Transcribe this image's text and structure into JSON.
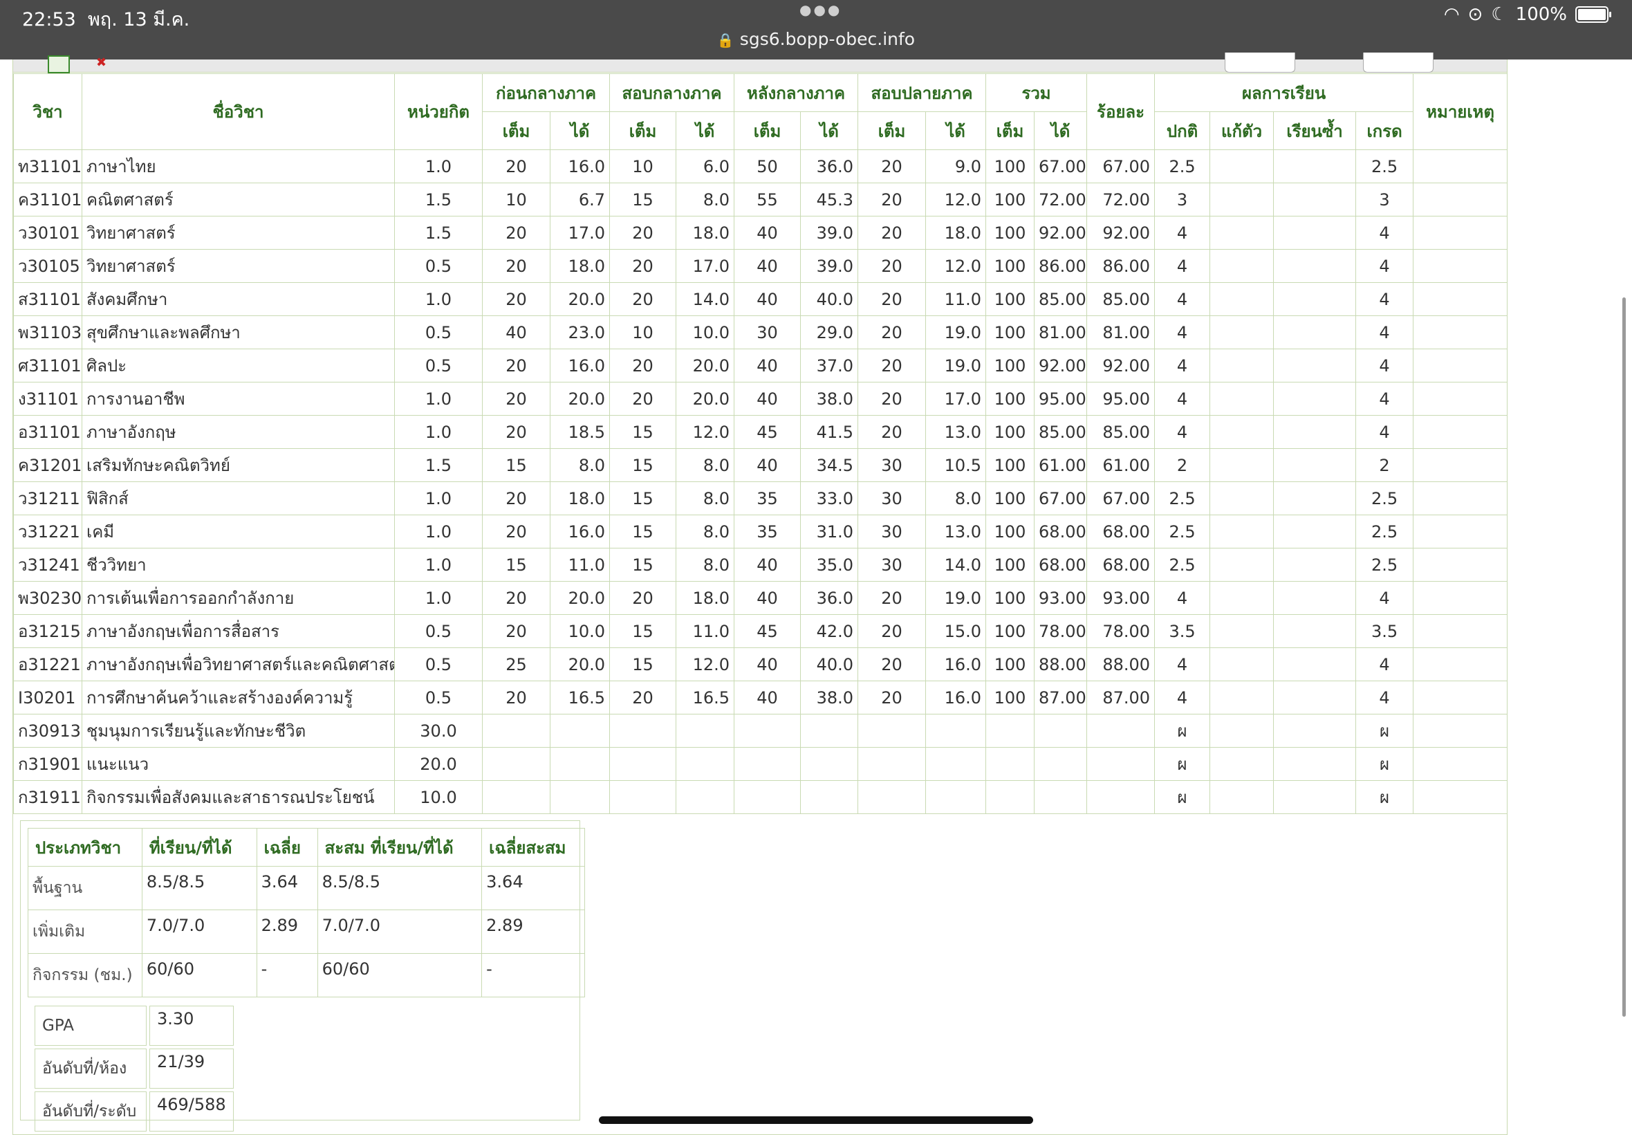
{
  "status": {
    "time": "22:53",
    "date": "พฤ. 13 มี.ค.",
    "url": "sgs6.bopp-obec.info",
    "battery": "100%"
  },
  "headers": {
    "subject_code": "วิชา",
    "subject_name": "ชื่อวิชา",
    "credits": "หน่วยกิต",
    "before_mid": "ก่อนกลางภาค",
    "midterm": "สอบกลางภาค",
    "after_mid": "หลังกลางภาค",
    "final": "สอบปลายภาค",
    "total": "รวม",
    "percent": "ร้อยละ",
    "results": "ผลการเรียน",
    "remark": "หมายเหตุ",
    "full": "เต็ม",
    "got": "ได้",
    "normal": "ปกติ",
    "fix": "แก้ตัว",
    "repeat": "เรียนซ้ำ",
    "grade": "เกรด"
  },
  "rows": [
    {
      "c0": "ท31101",
      "c1": "ภาษาไทย",
      "c2": "1.0",
      "c3": "20",
      "c4": "16.0",
      "c5": "10",
      "c6": "6.0",
      "c7": "50",
      "c8": "36.0",
      "c9": "20",
      "c10": "9.0",
      "c11": "100",
      "c12": "67.00",
      "c13": "67.00",
      "c14": "2.5",
      "c15": "",
      "c16": "",
      "c17": "2.5",
      "c18": ""
    },
    {
      "c0": "ค31101",
      "c1": "คณิตศาสตร์",
      "c2": "1.5",
      "c3": "10",
      "c4": "6.7",
      "c5": "15",
      "c6": "8.0",
      "c7": "55",
      "c8": "45.3",
      "c9": "20",
      "c10": "12.0",
      "c11": "100",
      "c12": "72.00",
      "c13": "72.00",
      "c14": "3",
      "c15": "",
      "c16": "",
      "c17": "3",
      "c18": ""
    },
    {
      "c0": "ว30101",
      "c1": "วิทยาศาสตร์",
      "c2": "1.5",
      "c3": "20",
      "c4": "17.0",
      "c5": "20",
      "c6": "18.0",
      "c7": "40",
      "c8": "39.0",
      "c9": "20",
      "c10": "18.0",
      "c11": "100",
      "c12": "92.00",
      "c13": "92.00",
      "c14": "4",
      "c15": "",
      "c16": "",
      "c17": "4",
      "c18": ""
    },
    {
      "c0": "ว30105",
      "c1": "วิทยาศาสตร์",
      "c2": "0.5",
      "c3": "20",
      "c4": "18.0",
      "c5": "20",
      "c6": "17.0",
      "c7": "40",
      "c8": "39.0",
      "c9": "20",
      "c10": "12.0",
      "c11": "100",
      "c12": "86.00",
      "c13": "86.00",
      "c14": "4",
      "c15": "",
      "c16": "",
      "c17": "4",
      "c18": ""
    },
    {
      "c0": "ส31101",
      "c1": "สังคมศึกษา",
      "c2": "1.0",
      "c3": "20",
      "c4": "20.0",
      "c5": "20",
      "c6": "14.0",
      "c7": "40",
      "c8": "40.0",
      "c9": "20",
      "c10": "11.0",
      "c11": "100",
      "c12": "85.00",
      "c13": "85.00",
      "c14": "4",
      "c15": "",
      "c16": "",
      "c17": "4",
      "c18": ""
    },
    {
      "c0": "พ31103",
      "c1": "สุขศึกษาและพลศึกษา",
      "c2": "0.5",
      "c3": "40",
      "c4": "23.0",
      "c5": "10",
      "c6": "10.0",
      "c7": "30",
      "c8": "29.0",
      "c9": "20",
      "c10": "19.0",
      "c11": "100",
      "c12": "81.00",
      "c13": "81.00",
      "c14": "4",
      "c15": "",
      "c16": "",
      "c17": "4",
      "c18": ""
    },
    {
      "c0": "ศ31101",
      "c1": "ศิลปะ",
      "c2": "0.5",
      "c3": "20",
      "c4": "16.0",
      "c5": "20",
      "c6": "20.0",
      "c7": "40",
      "c8": "37.0",
      "c9": "20",
      "c10": "19.0",
      "c11": "100",
      "c12": "92.00",
      "c13": "92.00",
      "c14": "4",
      "c15": "",
      "c16": "",
      "c17": "4",
      "c18": ""
    },
    {
      "c0": "ง31101",
      "c1": "การงานอาชีพ",
      "c2": "1.0",
      "c3": "20",
      "c4": "20.0",
      "c5": "20",
      "c6": "20.0",
      "c7": "40",
      "c8": "38.0",
      "c9": "20",
      "c10": "17.0",
      "c11": "100",
      "c12": "95.00",
      "c13": "95.00",
      "c14": "4",
      "c15": "",
      "c16": "",
      "c17": "4",
      "c18": ""
    },
    {
      "c0": "อ31101",
      "c1": "ภาษาอังกฤษ",
      "c2": "1.0",
      "c3": "20",
      "c4": "18.5",
      "c5": "15",
      "c6": "12.0",
      "c7": "45",
      "c8": "41.5",
      "c9": "20",
      "c10": "13.0",
      "c11": "100",
      "c12": "85.00",
      "c13": "85.00",
      "c14": "4",
      "c15": "",
      "c16": "",
      "c17": "4",
      "c18": ""
    },
    {
      "c0": "ค31201",
      "c1": "เสริมทักษะคณิตวิทย์",
      "c2": "1.5",
      "c3": "15",
      "c4": "8.0",
      "c5": "15",
      "c6": "8.0",
      "c7": "40",
      "c8": "34.5",
      "c9": "30",
      "c10": "10.5",
      "c11": "100",
      "c12": "61.00",
      "c13": "61.00",
      "c14": "2",
      "c15": "",
      "c16": "",
      "c17": "2",
      "c18": ""
    },
    {
      "c0": "ว31211",
      "c1": "ฟิสิกส์",
      "c2": "1.0",
      "c3": "20",
      "c4": "18.0",
      "c5": "15",
      "c6": "8.0",
      "c7": "35",
      "c8": "33.0",
      "c9": "30",
      "c10": "8.0",
      "c11": "100",
      "c12": "67.00",
      "c13": "67.00",
      "c14": "2.5",
      "c15": "",
      "c16": "",
      "c17": "2.5",
      "c18": ""
    },
    {
      "c0": "ว31221",
      "c1": "เคมี",
      "c2": "1.0",
      "c3": "20",
      "c4": "16.0",
      "c5": "15",
      "c6": "8.0",
      "c7": "35",
      "c8": "31.0",
      "c9": "30",
      "c10": "13.0",
      "c11": "100",
      "c12": "68.00",
      "c13": "68.00",
      "c14": "2.5",
      "c15": "",
      "c16": "",
      "c17": "2.5",
      "c18": ""
    },
    {
      "c0": "ว31241",
      "c1": "ชีววิทยา",
      "c2": "1.0",
      "c3": "15",
      "c4": "11.0",
      "c5": "15",
      "c6": "8.0",
      "c7": "40",
      "c8": "35.0",
      "c9": "30",
      "c10": "14.0",
      "c11": "100",
      "c12": "68.00",
      "c13": "68.00",
      "c14": "2.5",
      "c15": "",
      "c16": "",
      "c17": "2.5",
      "c18": ""
    },
    {
      "c0": "พ30230",
      "c1": "การเต้นเพื่อการออกกำลังกาย",
      "c2": "1.0",
      "c3": "20",
      "c4": "20.0",
      "c5": "20",
      "c6": "18.0",
      "c7": "40",
      "c8": "36.0",
      "c9": "20",
      "c10": "19.0",
      "c11": "100",
      "c12": "93.00",
      "c13": "93.00",
      "c14": "4",
      "c15": "",
      "c16": "",
      "c17": "4",
      "c18": ""
    },
    {
      "c0": "อ31215",
      "c1": "ภาษาอังกฤษเพื่อการสื่อสาร",
      "c2": "0.5",
      "c3": "20",
      "c4": "10.0",
      "c5": "15",
      "c6": "11.0",
      "c7": "45",
      "c8": "42.0",
      "c9": "20",
      "c10": "15.0",
      "c11": "100",
      "c12": "78.00",
      "c13": "78.00",
      "c14": "3.5",
      "c15": "",
      "c16": "",
      "c17": "3.5",
      "c18": ""
    },
    {
      "c0": "อ31221",
      "c1": "ภาษาอังกฤษเพื่อวิทยาศาสตร์และคณิตศาสตร์",
      "c2": "0.5",
      "c3": "25",
      "c4": "20.0",
      "c5": "15",
      "c6": "12.0",
      "c7": "40",
      "c8": "40.0",
      "c9": "20",
      "c10": "16.0",
      "c11": "100",
      "c12": "88.00",
      "c13": "88.00",
      "c14": "4",
      "c15": "",
      "c16": "",
      "c17": "4",
      "c18": ""
    },
    {
      "c0": "I30201",
      "c1": "การศึกษาค้นคว้าและสร้างองค์ความรู้",
      "c2": "0.5",
      "c3": "20",
      "c4": "16.5",
      "c5": "20",
      "c6": "16.5",
      "c7": "40",
      "c8": "38.0",
      "c9": "20",
      "c10": "16.0",
      "c11": "100",
      "c12": "87.00",
      "c13": "87.00",
      "c14": "4",
      "c15": "",
      "c16": "",
      "c17": "4",
      "c18": ""
    },
    {
      "c0": "ก30913",
      "c1": "ชุมนุมการเรียนรู้และทักษะชีวิต",
      "c2": "30.0",
      "c3": "",
      "c4": "",
      "c5": "",
      "c6": "",
      "c7": "",
      "c8": "",
      "c9": "",
      "c10": "",
      "c11": "",
      "c12": "",
      "c13": "",
      "c14": "ผ",
      "c15": "",
      "c16": "",
      "c17": "ผ",
      "c18": ""
    },
    {
      "c0": "ก31901",
      "c1": "แนะแนว",
      "c2": "20.0",
      "c3": "",
      "c4": "",
      "c5": "",
      "c6": "",
      "c7": "",
      "c8": "",
      "c9": "",
      "c10": "",
      "c11": "",
      "c12": "",
      "c13": "",
      "c14": "ผ",
      "c15": "",
      "c16": "",
      "c17": "ผ",
      "c18": ""
    },
    {
      "c0": "ก31911",
      "c1": "กิจกรรมเพื่อสังคมและสาธารณประโยชน์",
      "c2": "10.0",
      "c3": "",
      "c4": "",
      "c5": "",
      "c6": "",
      "c7": "",
      "c8": "",
      "c9": "",
      "c10": "",
      "c11": "",
      "c12": "",
      "c13": "",
      "c14": "ผ",
      "c15": "",
      "c16": "",
      "c17": "ผ",
      "c18": ""
    }
  ],
  "summary": {
    "headers": [
      "ประเภทวิชา",
      "ที่เรียน/ที่ได้",
      "เฉลี่ย",
      "สะสม ที่เรียน/ที่ได้",
      "เฉลี่ยสะสม"
    ],
    "rows": [
      [
        "พื้นฐาน",
        "8.5/8.5",
        "3.64",
        "8.5/8.5",
        "3.64"
      ],
      [
        "เพิ่มเติม",
        "7.0/7.0",
        "2.89",
        "7.0/7.0",
        "2.89"
      ],
      [
        "กิจกรรม (ชม.)",
        "60/60",
        "-",
        "60/60",
        "-"
      ]
    ],
    "gpa_label": "GPA",
    "gpa": "3.30",
    "rank_room_label": "อันดับที่/ห้อง",
    "rank_room": "21/39",
    "rank_level_label": "อันดับที่/ระดับ",
    "rank_level": "469/588"
  }
}
